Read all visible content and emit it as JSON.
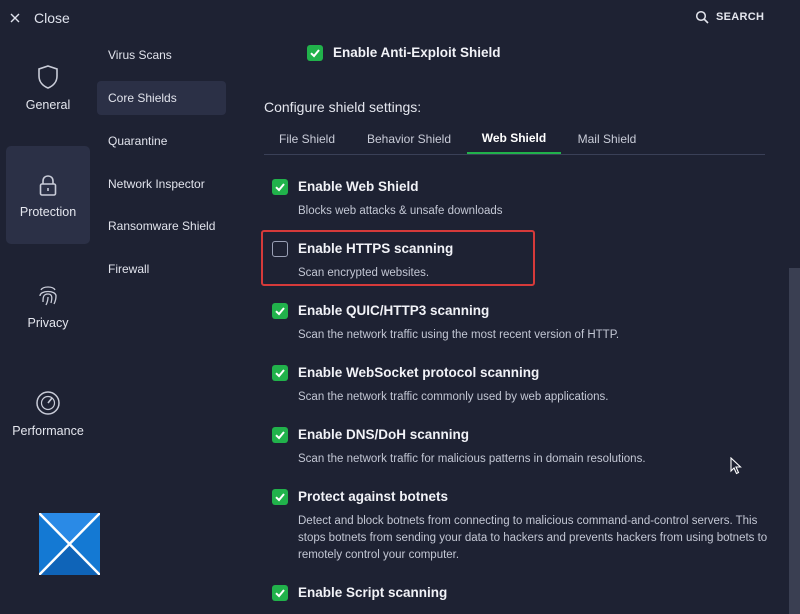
{
  "header": {
    "close_label": "Close",
    "search_label": "SEARCH"
  },
  "categories": [
    {
      "label": "General",
      "icon": "shield-icon"
    },
    {
      "label": "Protection",
      "icon": "lock-icon",
      "active": true
    },
    {
      "label": "Privacy",
      "icon": "fingerprint-icon"
    },
    {
      "label": "Performance",
      "icon": "speedometer-icon"
    }
  ],
  "subnav": [
    {
      "label": "Virus Scans"
    },
    {
      "label": "Core Shields",
      "active": true
    },
    {
      "label": "Quarantine"
    },
    {
      "label": "Network Inspector"
    },
    {
      "label": "Ransomware Shield"
    },
    {
      "label": "Firewall"
    }
  ],
  "anti_exploit": {
    "label": "Enable Anti-Exploit Shield",
    "checked": true
  },
  "configure_heading": "Configure shield settings:",
  "tabs": [
    {
      "label": "File Shield"
    },
    {
      "label": "Behavior Shield"
    },
    {
      "label": "Web Shield",
      "active": true
    },
    {
      "label": "Mail Shield"
    }
  ],
  "options": [
    {
      "title": "Enable Web Shield",
      "desc": "Blocks web attacks & unsafe downloads",
      "checked": true
    },
    {
      "title": "Enable HTTPS scanning",
      "desc": "Scan encrypted websites.",
      "checked": false,
      "highlighted": true
    },
    {
      "title": "Enable QUIC/HTTP3 scanning",
      "desc": "Scan the network traffic using the most recent version of HTTP.",
      "checked": true
    },
    {
      "title": "Enable WebSocket protocol scanning",
      "desc": "Scan the network traffic commonly used by web applications.",
      "checked": true
    },
    {
      "title": "Enable DNS/DoH scanning",
      "desc": "Scan the network traffic for malicious patterns in domain resolutions.",
      "checked": true
    },
    {
      "title": "Protect against botnets",
      "desc": "Detect and block botnets from connecting to malicious command-and-control servers. This stops botnets from sending your data to hackers and prevents hackers from using botnets to remotely control your computer.",
      "checked": true
    },
    {
      "title": "Enable Script scanning",
      "desc": "",
      "checked": true
    }
  ],
  "colors": {
    "background": "#1e2233",
    "active_item": "#2b3046",
    "check_green": "#21b24b",
    "highlight_red": "#d63a3a"
  }
}
